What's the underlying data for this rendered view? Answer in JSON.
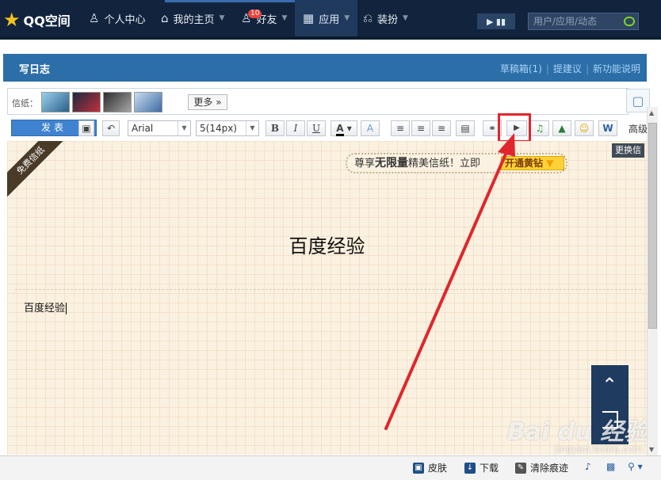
{
  "topbar": {
    "logo": "QQ空间",
    "nav": [
      {
        "label": "个人中心",
        "icon": "person-icon"
      },
      {
        "label": "我的主页",
        "icon": "home-icon"
      },
      {
        "label": "好友",
        "icon": "friends-icon",
        "badge": "10"
      },
      {
        "label": "应用",
        "icon": "apps-icon"
      },
      {
        "label": "装扮",
        "icon": "shirt-icon"
      }
    ],
    "search_placeholder": "用户/应用/动态"
  },
  "panel": {
    "title": "写日志",
    "links": [
      "草稿箱(1)",
      "提建议",
      "新功能说明"
    ]
  },
  "stationery": {
    "label": "信纸：",
    "more_label": "更多"
  },
  "toolbar": {
    "publish_label": "发表",
    "font_name": "Arial",
    "font_size": "5(14px)",
    "bold": "B",
    "italic": "I",
    "underline": "U",
    "advanced_label": "高级"
  },
  "editor": {
    "ribbon": "免费信纸",
    "promo_text": "尊享",
    "promo_bold": "无限量",
    "promo_text2": "精美信纸！立即",
    "promo_button": "开通黄钻",
    "title": "百度经验",
    "body": "百度经验",
    "change_tip": "更换信"
  },
  "statusbar": {
    "skin": "皮肤",
    "download": "下载",
    "clear": "清除痕迹"
  },
  "watermark": {
    "main": "Bai du 经验",
    "sub": "jingyan.baidu.com"
  },
  "colors": {
    "nav_bg": "#12243d",
    "panel_head": "#2b6ea8",
    "highlight": "#e0262c",
    "editor_bg": "#fbf1e1"
  }
}
